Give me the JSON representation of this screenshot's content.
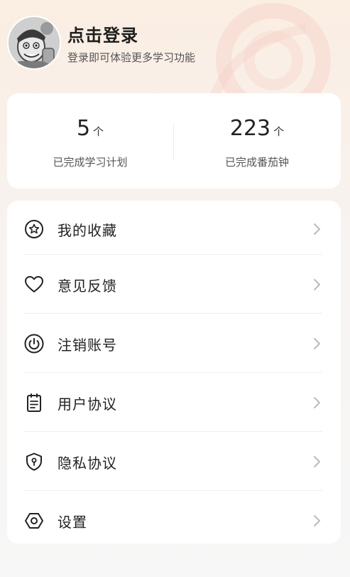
{
  "profile": {
    "title": "点击登录",
    "subtitle": "登录即可体验更多学习功能",
    "avatar_icon": "cartoon-avatar"
  },
  "stats": [
    {
      "value": "5",
      "unit": "个",
      "label": "已完成学习计划"
    },
    {
      "value": "223",
      "unit": "个",
      "label": "已完成番茄钟"
    }
  ],
  "menu": [
    {
      "label": "我的收藏",
      "icon": "star-circle-icon"
    },
    {
      "label": "意见反馈",
      "icon": "heart-icon"
    },
    {
      "label": "注销账号",
      "icon": "power-icon"
    },
    {
      "label": "用户协议",
      "icon": "clipboard-icon"
    },
    {
      "label": "隐私协议",
      "icon": "shield-icon"
    },
    {
      "label": "设置",
      "icon": "hexagon-settings-icon"
    }
  ],
  "colors": {
    "accent_top": "#fbeee2",
    "background": "#f7f7f7",
    "card": "#ffffff",
    "text": "#222222",
    "chevron": "#bbbbbb"
  }
}
